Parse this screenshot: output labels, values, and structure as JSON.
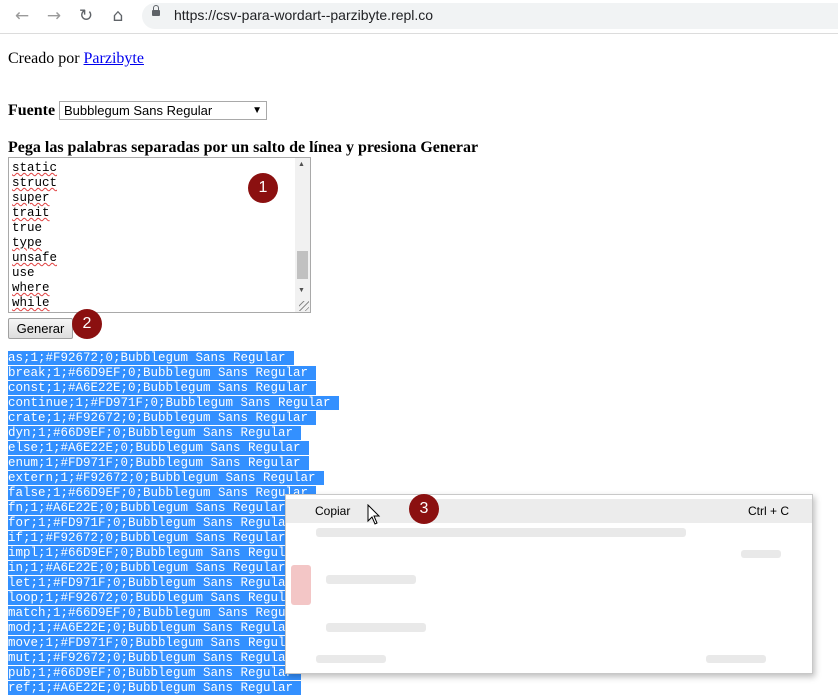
{
  "browser": {
    "url": "https://csv-para-wordart--parzibyte.repl.co"
  },
  "page": {
    "created_by_text": "Creado por ",
    "created_by_link": "Parzibyte",
    "font_label": "Fuente",
    "font_selected": "Bubblegum Sans Regular",
    "instructions": "Pega las palabras separadas por un salto de línea y presiona Generar",
    "textarea_lines": [
      "static",
      "struct",
      "super",
      "trait",
      "true",
      "type",
      "unsafe",
      "use",
      "where",
      "while"
    ],
    "generate_button": "Generar",
    "output_lines": [
      "as;1;#F92672;0;Bubblegum Sans Regular",
      "break;1;#66D9EF;0;Bubblegum Sans Regular",
      "const;1;#A6E22E;0;Bubblegum Sans Regular",
      "continue;1;#FD971F;0;Bubblegum Sans Regular",
      "crate;1;#F92672;0;Bubblegum Sans Regular",
      "dyn;1;#66D9EF;0;Bubblegum Sans Regular",
      "else;1;#A6E22E;0;Bubblegum Sans Regular",
      "enum;1;#FD971F;0;Bubblegum Sans Regular",
      "extern;1;#F92672;0;Bubblegum Sans Regular",
      "false;1;#66D9EF;0;Bubblegum Sans Regular",
      "fn;1;#A6E22E;0;Bubblegum Sans Regular",
      "for;1;#FD971F;0;Bubblegum Sans Regular",
      "if;1;#F92672;0;Bubblegum Sans Regular",
      "impl;1;#66D9EF;0;Bubblegum Sans Regular",
      "in;1;#A6E22E;0;Bubblegum Sans Regular",
      "let;1;#FD971F;0;Bubblegum Sans Regular",
      "loop;1;#F92672;0;Bubblegum Sans Regular",
      "match;1;#66D9EF;0;Bubblegum Sans Regular",
      "mod;1;#A6E22E;0;Bubblegum Sans Regular",
      "move;1;#FD971F;0;Bubblegum Sans Regular",
      "mut;1;#F92672;0;Bubblegum Sans Regular",
      "pub;1;#66D9EF;0;Bubblegum Sans Regular",
      "ref;1;#A6E22E;0;Bubblegum Sans Regular"
    ]
  },
  "context_menu": {
    "copy_label": "Copiar",
    "copy_shortcut": "Ctrl + C"
  },
  "badges": [
    "1",
    "2",
    "3"
  ],
  "colors": {
    "selection": "#3390ff",
    "badge": "#8b1010",
    "link": "#0000ee"
  },
  "icons": {
    "back": "arrow-left-icon",
    "forward": "arrow-right-icon",
    "reload": "reload-icon",
    "home": "home-icon",
    "lock": "lock-icon",
    "cursor": "mouse-pointer-icon"
  }
}
